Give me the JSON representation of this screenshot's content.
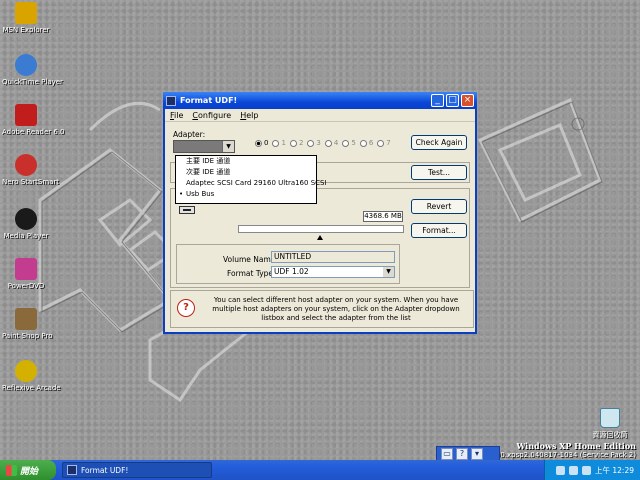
{
  "desktop": {
    "icons": [
      {
        "label": "MSN Explorer",
        "color": "#d9a400"
      },
      {
        "label": "QuickTime Player",
        "color": "#3b7bd1"
      },
      {
        "label": "Adobe Reader 6.0",
        "color": "#c21d1d"
      },
      {
        "label": "Nero StartSmart",
        "color": "#c9302c"
      },
      {
        "label": "Media Player",
        "color": "#1a1a1a"
      },
      {
        "label": "PowerDVD",
        "color": "#c43c8f"
      },
      {
        "label": "Paint Shop Pro",
        "color": "#8a6a3a"
      },
      {
        "label": "Reflexive Arcade",
        "color": "#d4b000"
      }
    ],
    "recycle_bin": "資源回收筒",
    "watermark_line1": "Windows XP Home Edition",
    "watermark_line2": "Build 2600.xpsp2.040817-1034 (Service Pack 2)"
  },
  "window": {
    "title": "Format UDF!",
    "menu": [
      {
        "key": "F",
        "rest": "ile"
      },
      {
        "key": "C",
        "rest": "onfigure"
      },
      {
        "key": "H",
        "rest": "elp"
      }
    ],
    "adapter_label": "Adapter:",
    "adapter_selected": "Usb Bus",
    "adapter_options": [
      "主要 IDE 通道",
      "次要 IDE 通道",
      "Adaptec SCSI Card 29160 Ultra160 SCSI",
      "Usb Bus"
    ],
    "radio_labels": [
      "0",
      "1",
      "2",
      "3",
      "4",
      "5",
      "6",
      "7"
    ],
    "radio_selected": "0",
    "buttons": {
      "check_again": "Check Again",
      "test": "Test...",
      "revert": "Revert",
      "format": "Format..."
    },
    "capacity": "4368.6 MB",
    "volume_name_label": "Volume Name:",
    "volume_name": "UNTITLED",
    "format_type_label": "Format Type:",
    "format_type": "UDF 1.02",
    "help_text": "You can select different host adapter on your system. When you have multiple host adapters on your system, click on the Adapter dropdown listbox and select the adapter from the list"
  },
  "taskbar": {
    "start_label": "開始",
    "task_label": "Format UDF!",
    "clock": "上午 12:29"
  }
}
